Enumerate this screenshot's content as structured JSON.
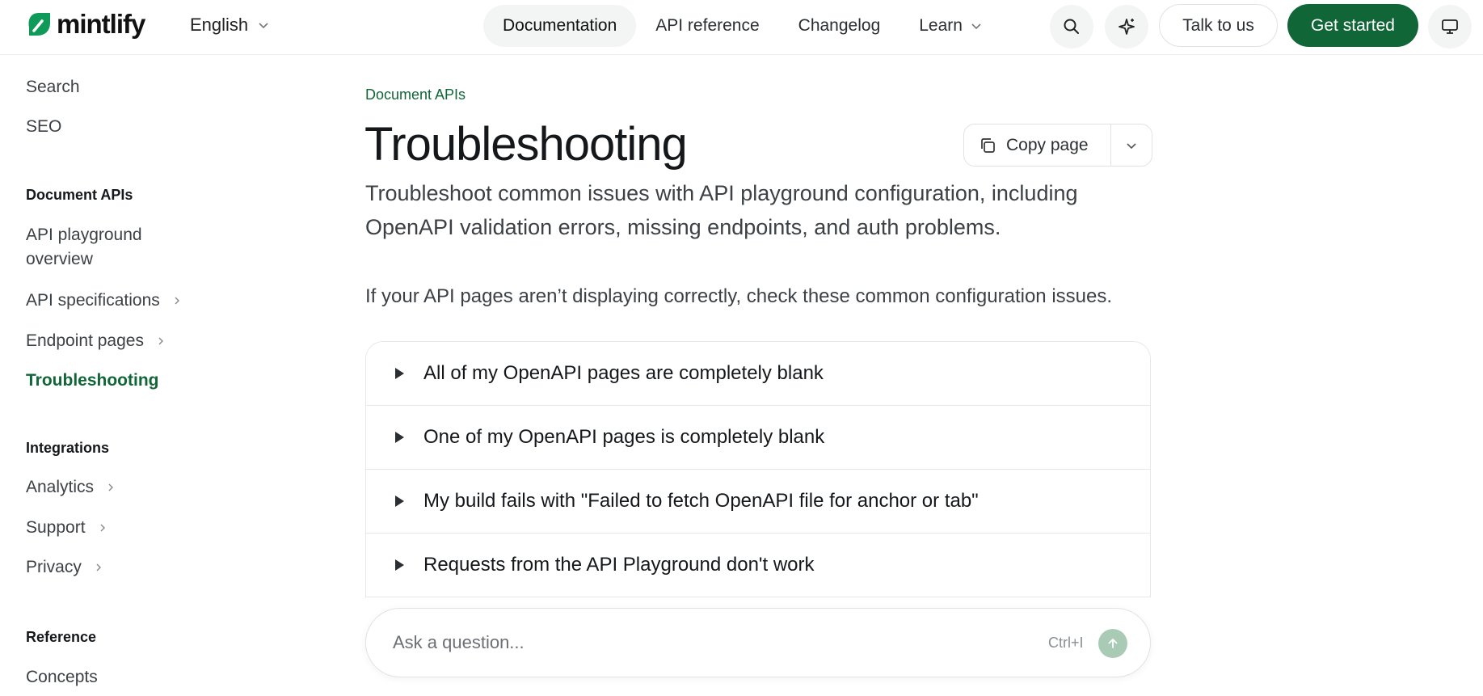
{
  "header": {
    "logo_text": "mintlify",
    "language": "English",
    "nav": [
      {
        "label": "Documentation"
      },
      {
        "label": "API reference"
      },
      {
        "label": "Changelog"
      },
      {
        "label": "Learn"
      }
    ],
    "talk_label": "Talk to us",
    "start_label": "Get started"
  },
  "sidebar": {
    "top_items": [
      {
        "label": "Search"
      },
      {
        "label": "SEO"
      }
    ],
    "groups": [
      {
        "heading": "Document APIs",
        "items": [
          {
            "label": "API playground overview"
          },
          {
            "label": "API specifications"
          },
          {
            "label": "Endpoint pages"
          },
          {
            "label": "Troubleshooting"
          }
        ]
      },
      {
        "heading": "Integrations",
        "items": [
          {
            "label": "Analytics"
          },
          {
            "label": "Support"
          },
          {
            "label": "Privacy"
          }
        ]
      },
      {
        "heading": "Reference",
        "items": [
          {
            "label": "Concepts"
          }
        ]
      }
    ]
  },
  "main": {
    "eyebrow": "Document APIs",
    "title": "Troubleshooting",
    "copy_label": "Copy page",
    "subtitle": "Troubleshoot common issues with API playground configuration, including OpenAPI validation errors, missing endpoints, and auth problems.",
    "intro": "If your API pages aren’t displaying correctly, check these common configuration issues.",
    "accordion": [
      {
        "label": "All of my OpenAPI pages are completely blank"
      },
      {
        "label": "One of my OpenAPI pages is completely blank"
      },
      {
        "label": "My build fails with \"Failed to fetch OpenAPI file for anchor or tab\""
      },
      {
        "label": "Requests from the API Playground don't work"
      }
    ]
  },
  "assistant": {
    "placeholder": "Ask a question...",
    "shortcut": "Ctrl+I"
  },
  "colors": {
    "brand": "#116638",
    "send_disabled": "#a9cbb6"
  }
}
